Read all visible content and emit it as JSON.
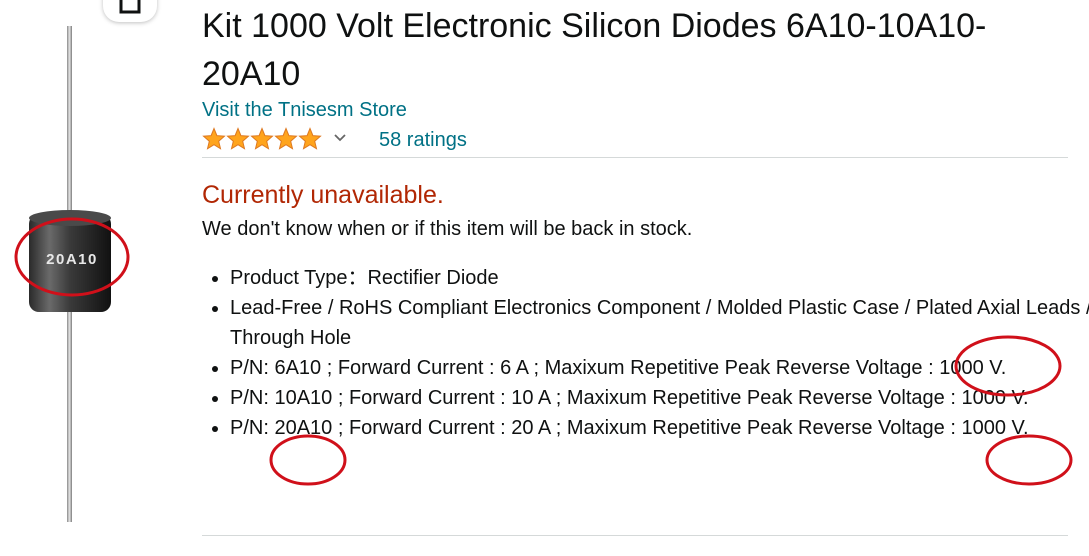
{
  "product": {
    "title": "Kit 1000 Volt Electronic Silicon Diodes 6A10-10A10-20A10",
    "store_link": "Visit the Tnisesm Store",
    "rating_stars": 5,
    "ratings_count": "58 ratings",
    "availability": "Currently unavailable.",
    "stock_message": "We don't know when or if this item will be back in stock.",
    "image_label": "20A10",
    "bullets": [
      "Product Type：Rectifier Diode",
      "Lead-Free / RoHS Compliant Electronics Component / Molded Plastic Case / Plated Axial Leads / Through Hole",
      "P/N: 6A10 ; Forward Current : 6 A ; Maxixum Repetitive Peak Reverse Voltage : 1000 V.",
      "P/N: 10A10 ; Forward Current : 10 A ; Maxixum Repetitive Peak Reverse Voltage : 1000 V.",
      "P/N: 20A10 ; Forward Current : 20 A ; Maxixum Repetitive Peak Reverse Voltage : 1000 V."
    ]
  },
  "colors": {
    "link": "#007185",
    "unavailable": "#b12704",
    "star": "#ffa41c",
    "annotation": "#d0101a"
  },
  "icons": [
    "share-icon",
    "star-icon",
    "chevron-down-icon"
  ]
}
